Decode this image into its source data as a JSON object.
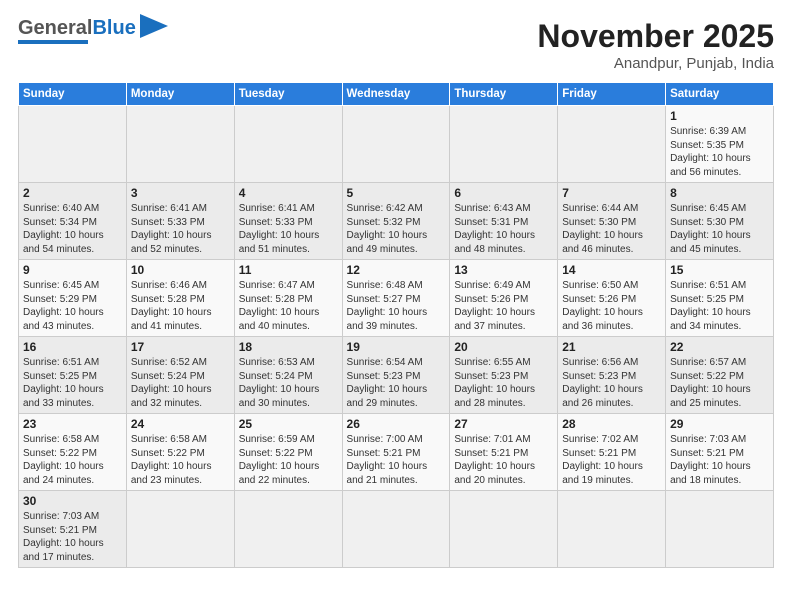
{
  "header": {
    "logo_general": "General",
    "logo_blue": "Blue",
    "title": "November 2025",
    "subtitle": "Anandpur, Punjab, India"
  },
  "weekdays": [
    "Sunday",
    "Monday",
    "Tuesday",
    "Wednesday",
    "Thursday",
    "Friday",
    "Saturday"
  ],
  "weeks": [
    [
      {
        "day": "",
        "info": ""
      },
      {
        "day": "",
        "info": ""
      },
      {
        "day": "",
        "info": ""
      },
      {
        "day": "",
        "info": ""
      },
      {
        "day": "",
        "info": ""
      },
      {
        "day": "",
        "info": ""
      },
      {
        "day": "1",
        "info": "Sunrise: 6:39 AM\nSunset: 5:35 PM\nDaylight: 10 hours and 56 minutes."
      }
    ],
    [
      {
        "day": "2",
        "info": "Sunrise: 6:40 AM\nSunset: 5:34 PM\nDaylight: 10 hours and 54 minutes."
      },
      {
        "day": "3",
        "info": "Sunrise: 6:41 AM\nSunset: 5:33 PM\nDaylight: 10 hours and 52 minutes."
      },
      {
        "day": "4",
        "info": "Sunrise: 6:41 AM\nSunset: 5:33 PM\nDaylight: 10 hours and 51 minutes."
      },
      {
        "day": "5",
        "info": "Sunrise: 6:42 AM\nSunset: 5:32 PM\nDaylight: 10 hours and 49 minutes."
      },
      {
        "day": "6",
        "info": "Sunrise: 6:43 AM\nSunset: 5:31 PM\nDaylight: 10 hours and 48 minutes."
      },
      {
        "day": "7",
        "info": "Sunrise: 6:44 AM\nSunset: 5:30 PM\nDaylight: 10 hours and 46 minutes."
      },
      {
        "day": "8",
        "info": "Sunrise: 6:45 AM\nSunset: 5:30 PM\nDaylight: 10 hours and 45 minutes."
      }
    ],
    [
      {
        "day": "9",
        "info": "Sunrise: 6:45 AM\nSunset: 5:29 PM\nDaylight: 10 hours and 43 minutes."
      },
      {
        "day": "10",
        "info": "Sunrise: 6:46 AM\nSunset: 5:28 PM\nDaylight: 10 hours and 41 minutes."
      },
      {
        "day": "11",
        "info": "Sunrise: 6:47 AM\nSunset: 5:28 PM\nDaylight: 10 hours and 40 minutes."
      },
      {
        "day": "12",
        "info": "Sunrise: 6:48 AM\nSunset: 5:27 PM\nDaylight: 10 hours and 39 minutes."
      },
      {
        "day": "13",
        "info": "Sunrise: 6:49 AM\nSunset: 5:26 PM\nDaylight: 10 hours and 37 minutes."
      },
      {
        "day": "14",
        "info": "Sunrise: 6:50 AM\nSunset: 5:26 PM\nDaylight: 10 hours and 36 minutes."
      },
      {
        "day": "15",
        "info": "Sunrise: 6:51 AM\nSunset: 5:25 PM\nDaylight: 10 hours and 34 minutes."
      }
    ],
    [
      {
        "day": "16",
        "info": "Sunrise: 6:51 AM\nSunset: 5:25 PM\nDaylight: 10 hours and 33 minutes."
      },
      {
        "day": "17",
        "info": "Sunrise: 6:52 AM\nSunset: 5:24 PM\nDaylight: 10 hours and 32 minutes."
      },
      {
        "day": "18",
        "info": "Sunrise: 6:53 AM\nSunset: 5:24 PM\nDaylight: 10 hours and 30 minutes."
      },
      {
        "day": "19",
        "info": "Sunrise: 6:54 AM\nSunset: 5:23 PM\nDaylight: 10 hours and 29 minutes."
      },
      {
        "day": "20",
        "info": "Sunrise: 6:55 AM\nSunset: 5:23 PM\nDaylight: 10 hours and 28 minutes."
      },
      {
        "day": "21",
        "info": "Sunrise: 6:56 AM\nSunset: 5:23 PM\nDaylight: 10 hours and 26 minutes."
      },
      {
        "day": "22",
        "info": "Sunrise: 6:57 AM\nSunset: 5:22 PM\nDaylight: 10 hours and 25 minutes."
      }
    ],
    [
      {
        "day": "23",
        "info": "Sunrise: 6:58 AM\nSunset: 5:22 PM\nDaylight: 10 hours and 24 minutes."
      },
      {
        "day": "24",
        "info": "Sunrise: 6:58 AM\nSunset: 5:22 PM\nDaylight: 10 hours and 23 minutes."
      },
      {
        "day": "25",
        "info": "Sunrise: 6:59 AM\nSunset: 5:22 PM\nDaylight: 10 hours and 22 minutes."
      },
      {
        "day": "26",
        "info": "Sunrise: 7:00 AM\nSunset: 5:21 PM\nDaylight: 10 hours and 21 minutes."
      },
      {
        "day": "27",
        "info": "Sunrise: 7:01 AM\nSunset: 5:21 PM\nDaylight: 10 hours and 20 minutes."
      },
      {
        "day": "28",
        "info": "Sunrise: 7:02 AM\nSunset: 5:21 PM\nDaylight: 10 hours and 19 minutes."
      },
      {
        "day": "29",
        "info": "Sunrise: 7:03 AM\nSunset: 5:21 PM\nDaylight: 10 hours and 18 minutes."
      }
    ],
    [
      {
        "day": "30",
        "info": "Sunrise: 7:03 AM\nSunset: 5:21 PM\nDaylight: 10 hours and 17 minutes."
      },
      {
        "day": "",
        "info": ""
      },
      {
        "day": "",
        "info": ""
      },
      {
        "day": "",
        "info": ""
      },
      {
        "day": "",
        "info": ""
      },
      {
        "day": "",
        "info": ""
      },
      {
        "day": "",
        "info": ""
      }
    ]
  ]
}
